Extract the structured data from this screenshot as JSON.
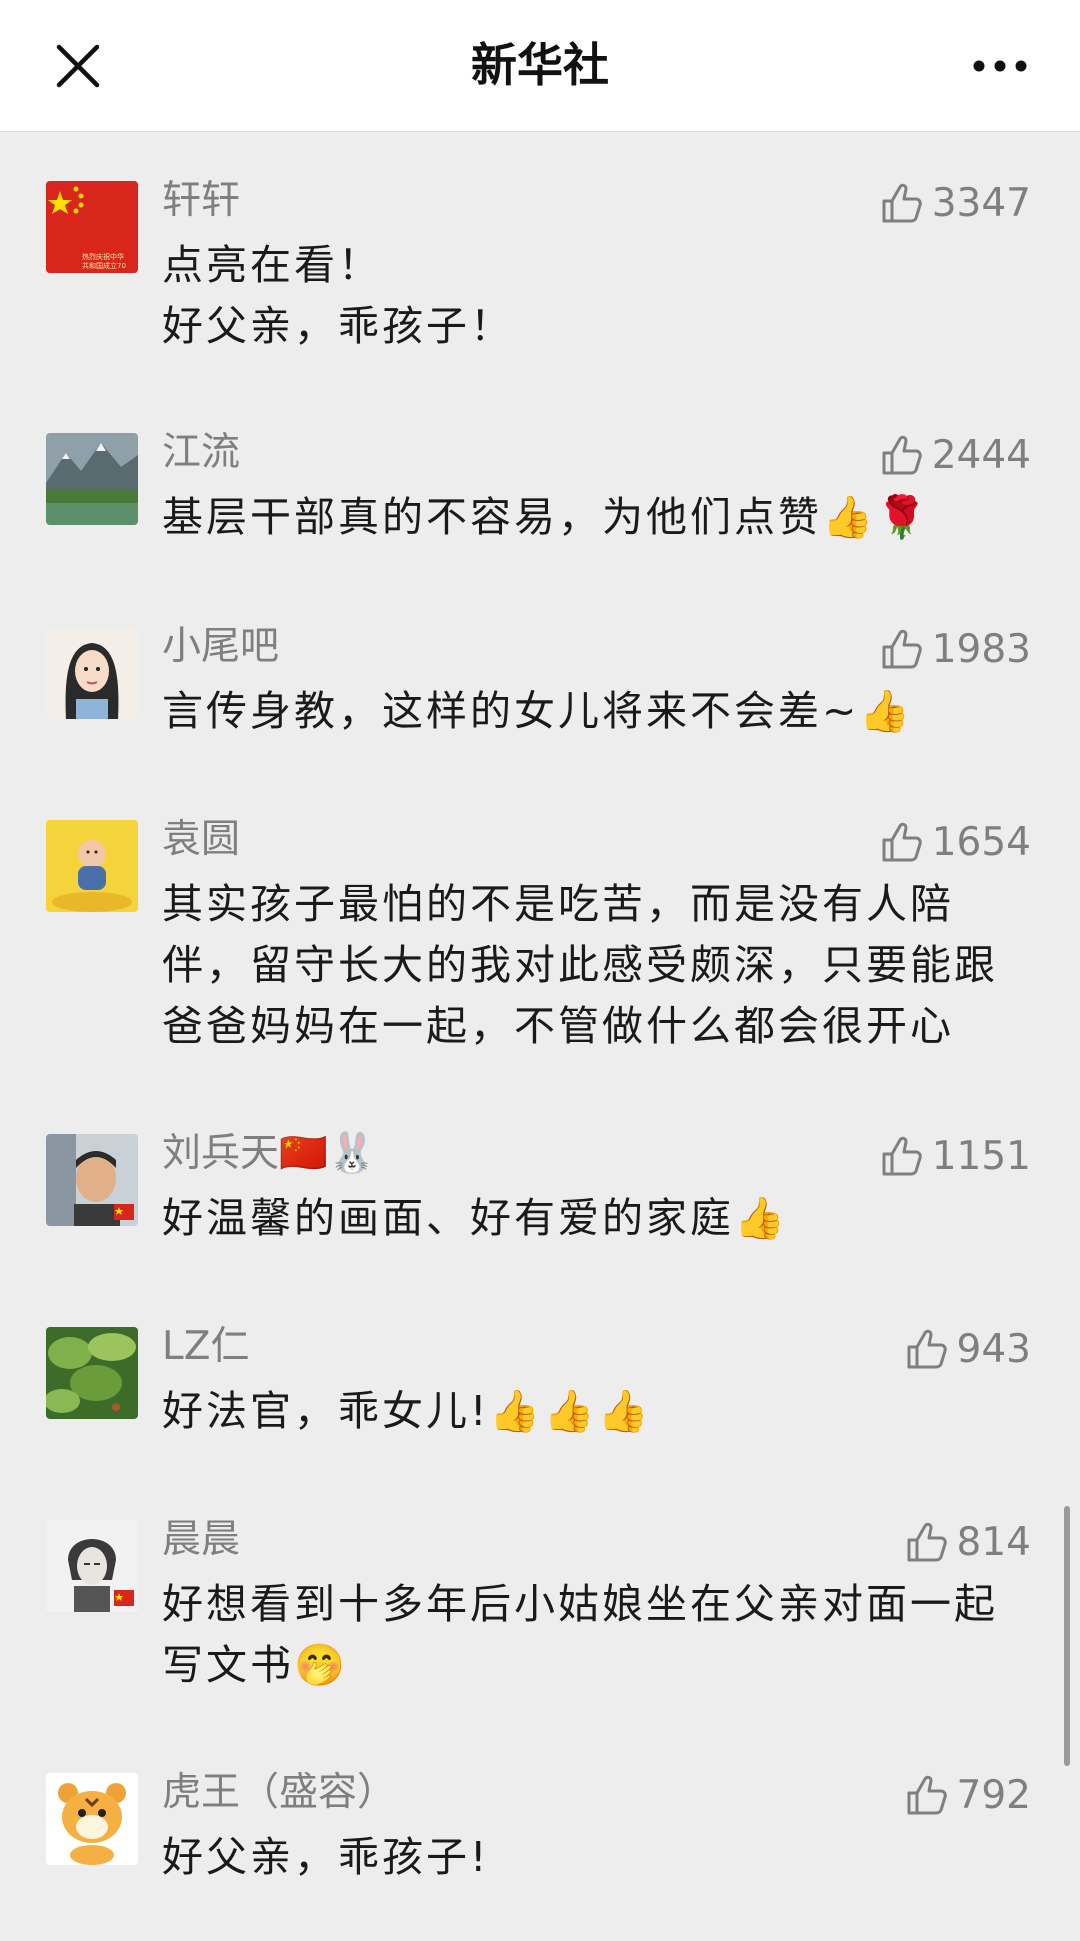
{
  "header": {
    "title": "新华社",
    "close_icon": "close-icon",
    "more_icon": "more-icon"
  },
  "comments": [
    {
      "username": "轩轩",
      "likes": "3347",
      "lines": [
        "点亮在看！",
        "好父亲，乖孩子！"
      ],
      "avatar": "china-flag-avatar",
      "avatar_text": "热烈庆祝中华人民共和国成立70"
    },
    {
      "username": "江流",
      "likes": "2444",
      "lines": [
        "基层干部真的不容易，为他们点赞👍🌹"
      ],
      "avatar": "mountain-lake-avatar"
    },
    {
      "username": "小尾吧",
      "likes": "1983",
      "lines": [
        "言传身教，这样的女儿将来不会差~👍"
      ],
      "avatar": "girl-drawing-avatar"
    },
    {
      "username": "袁圆",
      "likes": "1654",
      "lines": [
        "其实孩子最怕的不是吃苦，而是没有人陪",
        "伴，留守长大的我对此感受颇深，只要能跟",
        "爸爸妈妈在一起，不管做什么都会很开心"
      ],
      "avatar": "baby-yellow-avatar"
    },
    {
      "username": "刘兵天🇨🇳🐰",
      "likes": "1151",
      "lines": [
        "好温馨的画面、好有爱的家庭👍"
      ],
      "avatar": "man-portrait-avatar"
    },
    {
      "username": "LZ仁",
      "likes": "943",
      "lines": [
        "好法官，乖女儿!👍👍👍"
      ],
      "avatar": "green-leaves-avatar"
    },
    {
      "username": "晨晨",
      "likes": "814",
      "lines": [
        "好想看到十多年后小姑娘坐在父亲对面一起",
        "写文书🤭"
      ],
      "avatar": "sketch-person-avatar"
    },
    {
      "username": "虎王（盛容）",
      "likes": "792",
      "lines": [
        "好父亲，乖孩子!"
      ],
      "avatar": "tiger-cartoon-avatar"
    }
  ],
  "colors": {
    "background": "#ededed",
    "header_bg": "#ffffff",
    "username": "#7f7f7f",
    "content": "#1a1a1a"
  }
}
